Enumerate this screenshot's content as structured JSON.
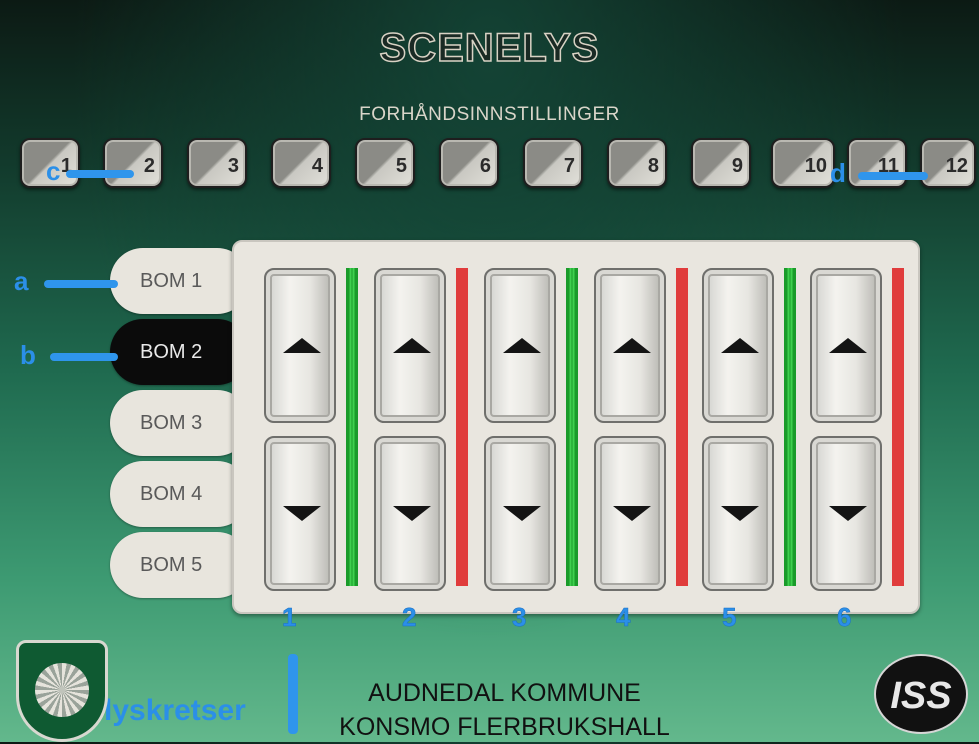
{
  "header": {
    "title": "SCENELYS",
    "subtitle": "FORHÅNDSINNSTILLINGER"
  },
  "presets": [
    "1",
    "2",
    "3",
    "4",
    "5",
    "6",
    "7",
    "8",
    "9",
    "10",
    "11",
    "12"
  ],
  "booms": [
    {
      "label": "BOM 1",
      "active": false
    },
    {
      "label": "BOM 2",
      "active": true
    },
    {
      "label": "BOM 3",
      "active": false
    },
    {
      "label": "BOM 4",
      "active": false
    },
    {
      "label": "BOM 5",
      "active": false
    }
  ],
  "channels": [
    {
      "number": "1",
      "status_color": "green"
    },
    {
      "number": "2",
      "status_color": "red"
    },
    {
      "number": "3",
      "status_color": "green"
    },
    {
      "number": "4",
      "status_color": "red"
    },
    {
      "number": "5",
      "status_color": "green"
    },
    {
      "number": "6",
      "status_color": "red"
    }
  ],
  "annotations": {
    "a": "a",
    "b": "b",
    "c": "c",
    "d": "d",
    "circuits": "lyskretser"
  },
  "footer": {
    "line1": "AUDNEDAL KOMMUNE",
    "line2": "KONSMO FLERBRUKSHALL"
  },
  "logos": {
    "left_icon": "municipal-crest-icon",
    "right_text": "ISS"
  },
  "colors": {
    "accent_blue": "#2b8fe8",
    "status_green": "#2fb83f",
    "status_red": "#e03c3c",
    "active_boom": "#0b0b0b"
  }
}
